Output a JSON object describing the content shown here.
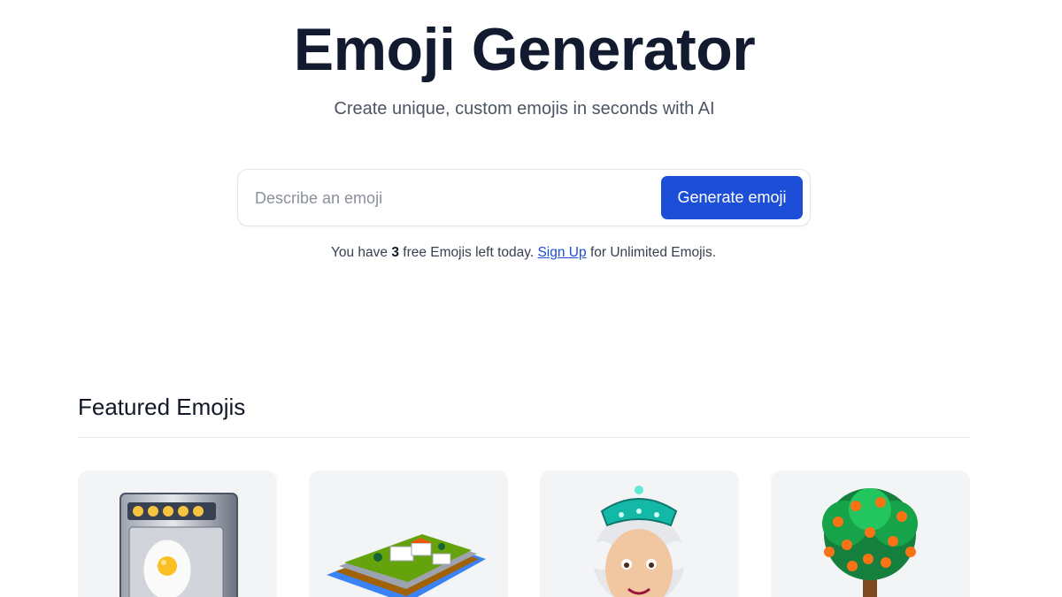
{
  "header": {
    "title": "Emoji Generator",
    "subtitle": "Create unique, custom emojis in seconds with AI"
  },
  "search": {
    "placeholder": "Describe an emoji",
    "value": "",
    "button_label": "Generate emoji"
  },
  "quota": {
    "prefix": "You have",
    "count": "3",
    "middle": "free Emojis left today.",
    "link_label": "Sign Up",
    "suffix": "for Unlimited Emojis."
  },
  "featured": {
    "title": "Featured Emojis",
    "items": [
      {
        "name": "egg-vending-machine-emoji"
      },
      {
        "name": "island-villa-emoji"
      },
      {
        "name": "queen-with-tiara-emoji"
      },
      {
        "name": "orange-tree-emoji"
      }
    ]
  },
  "colors": {
    "accent": "#1d4ed8",
    "title_text": "#111a2e",
    "card_bg": "#f3f4f6"
  }
}
